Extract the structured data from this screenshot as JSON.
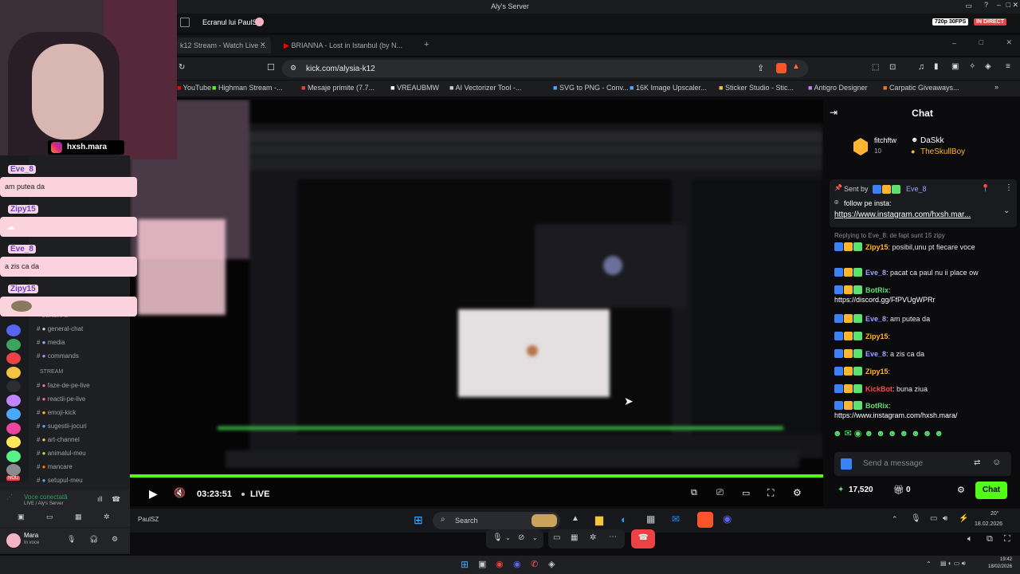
{
  "app_title": "Aly's Server",
  "share": {
    "title": "Ecranul lui PaulSZ",
    "quality": "720p 30FPS",
    "live_badge": "IN DIRECT"
  },
  "tabs": [
    {
      "label": "k12 Stream - Watch Live ..."
    },
    {
      "label": "BRIANNA - Lost in Istanbul (by N..."
    }
  ],
  "address": {
    "url": "kick.com/alysia-k12"
  },
  "bookmarks": [
    {
      "label": "YouTube"
    },
    {
      "label": "Highman Stream -..."
    },
    {
      "label": "Mesaje primite (7.7..."
    },
    {
      "label": "VREAUBMW"
    },
    {
      "label": "AI Vectorizer Tool -..."
    },
    {
      "label": "SVG to PNG - Conv..."
    },
    {
      "label": "16K Image Upscaler..."
    },
    {
      "label": "Sticker Studio - Stic..."
    },
    {
      "label": "Antigro Designer"
    },
    {
      "label": "Carpatic Giveaways..."
    }
  ],
  "player": {
    "time": "03:23:51",
    "live": "LIVE"
  },
  "chat": {
    "title": "Chat",
    "top_users": [
      "fitchftw",
      "DaSkk",
      "TheSkullBoy"
    ],
    "top_count": "10",
    "pinned": {
      "sent_by_label": "Sent by",
      "sent_by_user": "Eve_8",
      "text": "follow pe insta:",
      "link": "https://www.instagram.com/hxsh.mar..."
    },
    "reply_hint": "Replying to Eve_8: de fapt sunt 15 zipy",
    "messages": [
      {
        "user": "Zipy15",
        "color": "#ffb531",
        "text": ": posibil,unu pt fiecare voce"
      },
      {
        "user": "Eve_8",
        "color": "#9aa0ff",
        "text": ": pacat ca paul nu ii place ow"
      },
      {
        "user": "BotRix",
        "color": "#5ee26e",
        "text": ":",
        "link": "https://discord.gg/FfPVUgWPRr"
      },
      {
        "user": "Eve_8",
        "color": "#9aa0ff",
        "text": ": am putea da"
      },
      {
        "user": "Zipy15",
        "color": "#ffb531",
        "text": ":"
      },
      {
        "user": "Eve_8",
        "color": "#9aa0ff",
        "text": ": a zis ca da"
      },
      {
        "user": "Zipy15",
        "color": "#ffb531",
        "text": ":"
      },
      {
        "user": "KickBot",
        "color": "#ff4a4a",
        "text": ": buna ziua"
      },
      {
        "user": "BotRix",
        "color": "#5ee26e",
        "text": ":",
        "link": "https://www.instagram.com/hxsh.mara/"
      }
    ],
    "input_placeholder": "Send a message",
    "points": "17,520",
    "gift_count": "0",
    "send_label": "Chat"
  },
  "overlay": {
    "insta_handle": "hxsh.mara",
    "messages": [
      {
        "user": "Eve_8",
        "text": "am putea da"
      },
      {
        "user": "Zipy15",
        "text": ""
      },
      {
        "user": "Eve_8",
        "text": "a zis ca da"
      },
      {
        "user": "Zipy15",
        "text": ""
      }
    ]
  },
  "discord": {
    "categories": [
      "GENERAL",
      "STREAM"
    ],
    "channels_general": [
      "general-chat",
      "media",
      "commands"
    ],
    "channels_stream": [
      "faze-de-pe-live",
      "reactii-pe-live",
      "emoji-kick",
      "sugestii-jocuri",
      "art-channel",
      "animalul-meu",
      "mancare",
      "setupul-meu"
    ],
    "voice": {
      "status": "Voce conectată",
      "server": "LIVE / Aly's Server"
    },
    "user": {
      "name": "Mara",
      "status": "In voce"
    },
    "new_badge": "NOU"
  },
  "inner_taskbar": {
    "app": "PaulSZ",
    "search": "Search",
    "temp": "20°",
    "date": "18.02.2026"
  },
  "os_clock": {
    "time": "19:42",
    "date": "18/02/2026"
  }
}
